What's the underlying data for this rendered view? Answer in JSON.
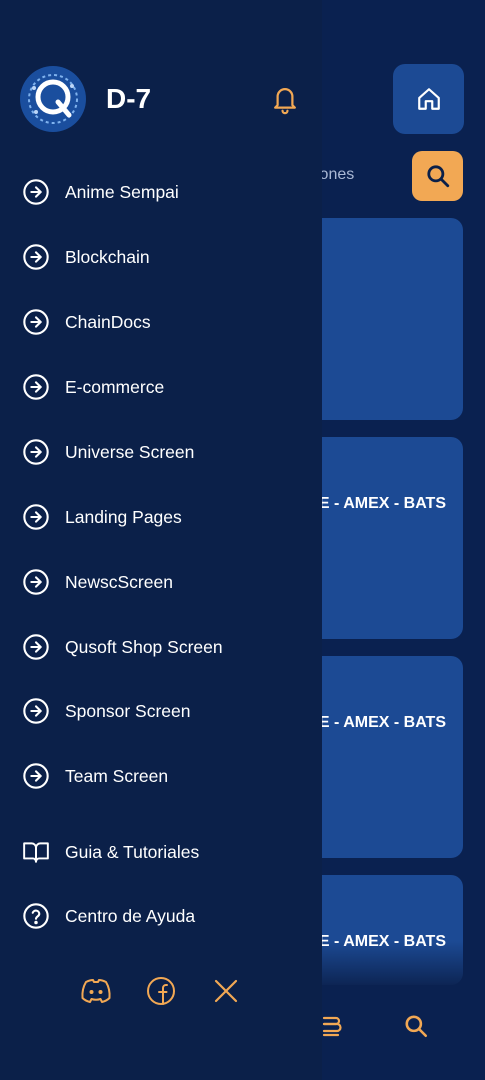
{
  "colors": {
    "drawer_bg": "#0b2049",
    "accent": "#f2a854",
    "card_bg": "#1c4a94",
    "text": "#ffffff"
  },
  "brand": {
    "title": "D-7",
    "logo_icon": "circular-q-logo"
  },
  "header": {
    "notification_icon": "bell-icon"
  },
  "menu": {
    "items": [
      {
        "label": "Anime Sempai",
        "icon": "arrow-circle-right-icon"
      },
      {
        "label": "Blockchain",
        "icon": "arrow-circle-right-icon"
      },
      {
        "label": "ChainDocs",
        "icon": "arrow-circle-right-icon"
      },
      {
        "label": "E-commerce",
        "icon": "arrow-circle-right-icon"
      },
      {
        "label": "Universe Screen",
        "icon": "arrow-circle-right-icon"
      },
      {
        "label": "Landing Pages",
        "icon": "arrow-circle-right-icon"
      },
      {
        "label": "NewscScreen",
        "icon": "arrow-circle-right-icon"
      },
      {
        "label": "Qusoft Shop Screen",
        "icon": "arrow-circle-right-icon"
      },
      {
        "label": "Sponsor Screen",
        "icon": "arrow-circle-right-icon"
      },
      {
        "label": "Team Screen",
        "icon": "arrow-circle-right-icon"
      }
    ],
    "guide": {
      "label": "Guia & Tutoriales",
      "icon": "book-icon"
    },
    "help": {
      "label": "Centro de Ayuda",
      "icon": "help-circle-icon"
    }
  },
  "social": [
    "discord-icon",
    "facebook-icon",
    "x-icon"
  ],
  "background": {
    "search_partial": "cciones",
    "cards": [
      {
        "title": ""
      },
      {
        "title": "E - AMEX - BATS"
      },
      {
        "title": "E - AMEX - BATS"
      },
      {
        "title": "E - AMEX - BATS"
      }
    ],
    "bottom_nav": [
      "menu-stack-icon",
      "search-icon"
    ]
  }
}
